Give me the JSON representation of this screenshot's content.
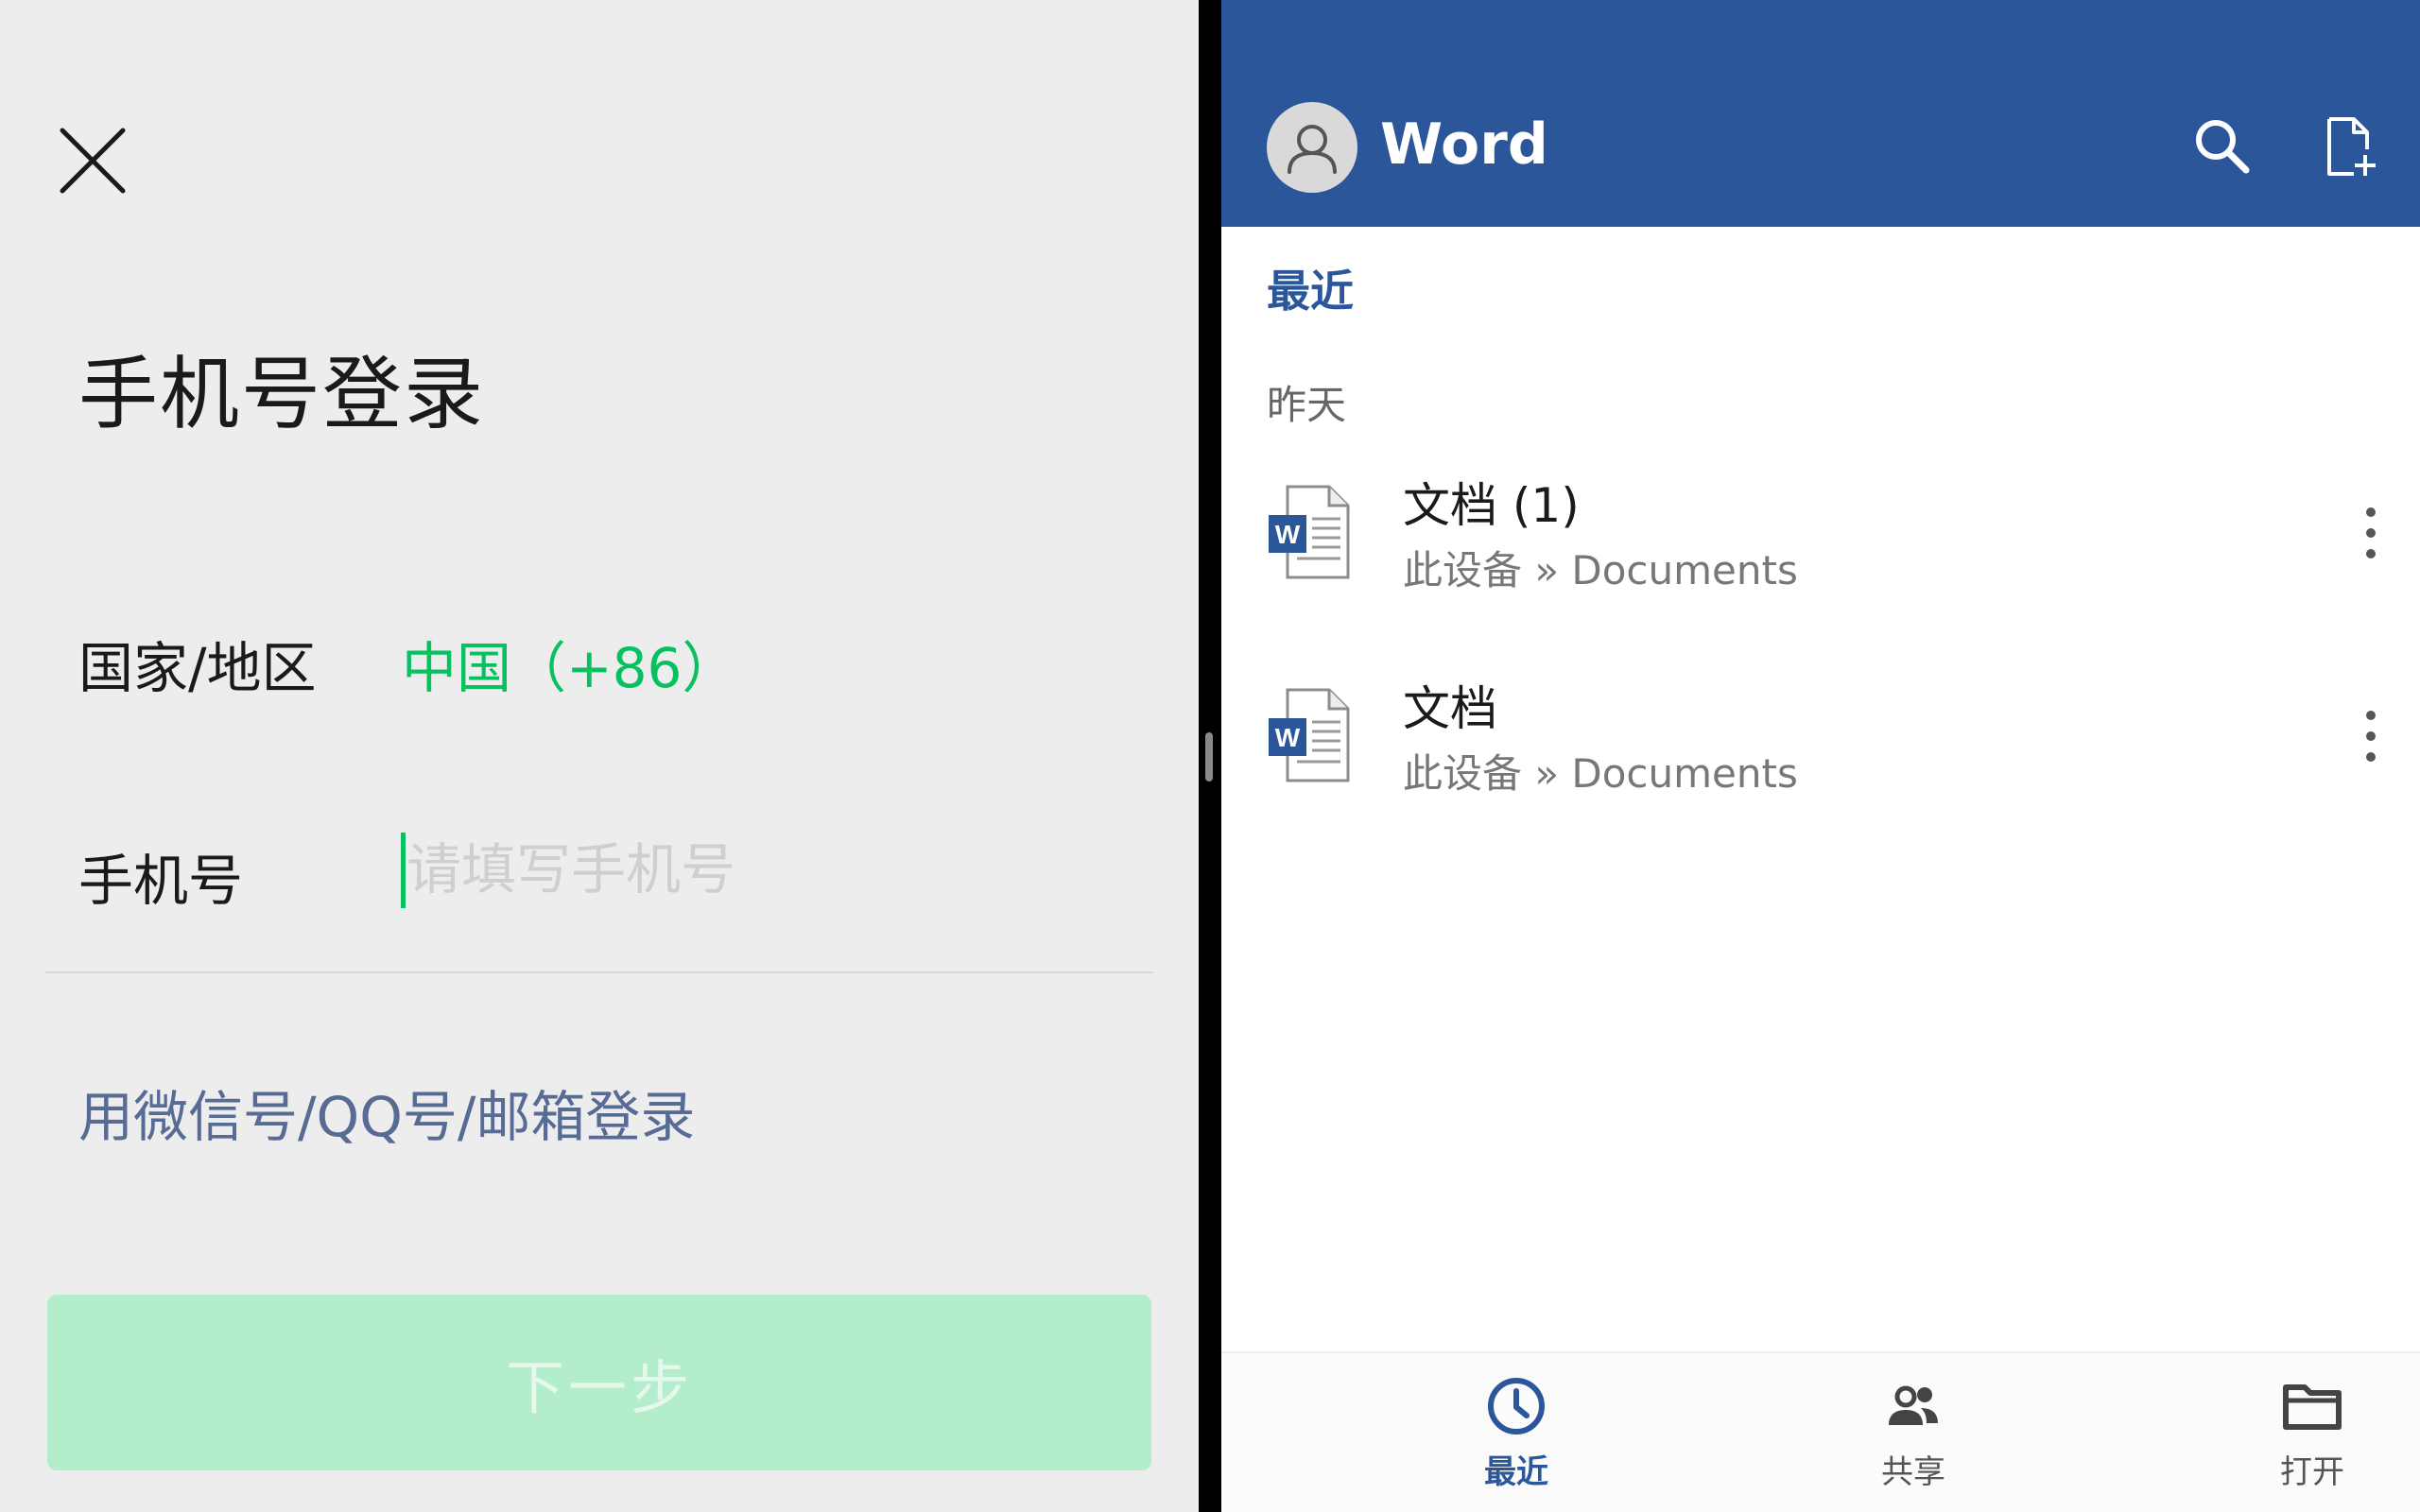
{
  "wechat_login": {
    "title": "手机号登录",
    "country_label": "国家/地区",
    "country_value": "中国（+86）",
    "phone_label": "手机号",
    "phone_placeholder": "请填写手机号",
    "phone_value": "",
    "alt_login_link": "用微信号/QQ号/邮箱登录",
    "next_button": "下一步",
    "close_icon": "close-icon",
    "colors": {
      "background": "#ededed",
      "accent_green": "#07c160",
      "link_blue": "#576b95",
      "disabled_button": "#b3edcc"
    }
  },
  "word": {
    "app_title": "Word",
    "header_icons": [
      "avatar-icon",
      "search-icon",
      "new-document-icon"
    ],
    "section_title": "最近",
    "group_label": "昨天",
    "files": [
      {
        "name": "文档 (1)",
        "path": "此设备 » Documents",
        "icon": "word-doc-icon"
      },
      {
        "name": "文档",
        "path": "此设备 » Documents",
        "icon": "word-doc-icon"
      }
    ],
    "bottom_nav": [
      {
        "label": "最近",
        "icon": "clock-icon",
        "active": true
      },
      {
        "label": "共享",
        "icon": "people-icon",
        "active": false
      },
      {
        "label": "打开",
        "icon": "folder-icon",
        "active": false
      }
    ],
    "colors": {
      "brand": "#2b579a",
      "header_text": "#ffffff"
    }
  }
}
